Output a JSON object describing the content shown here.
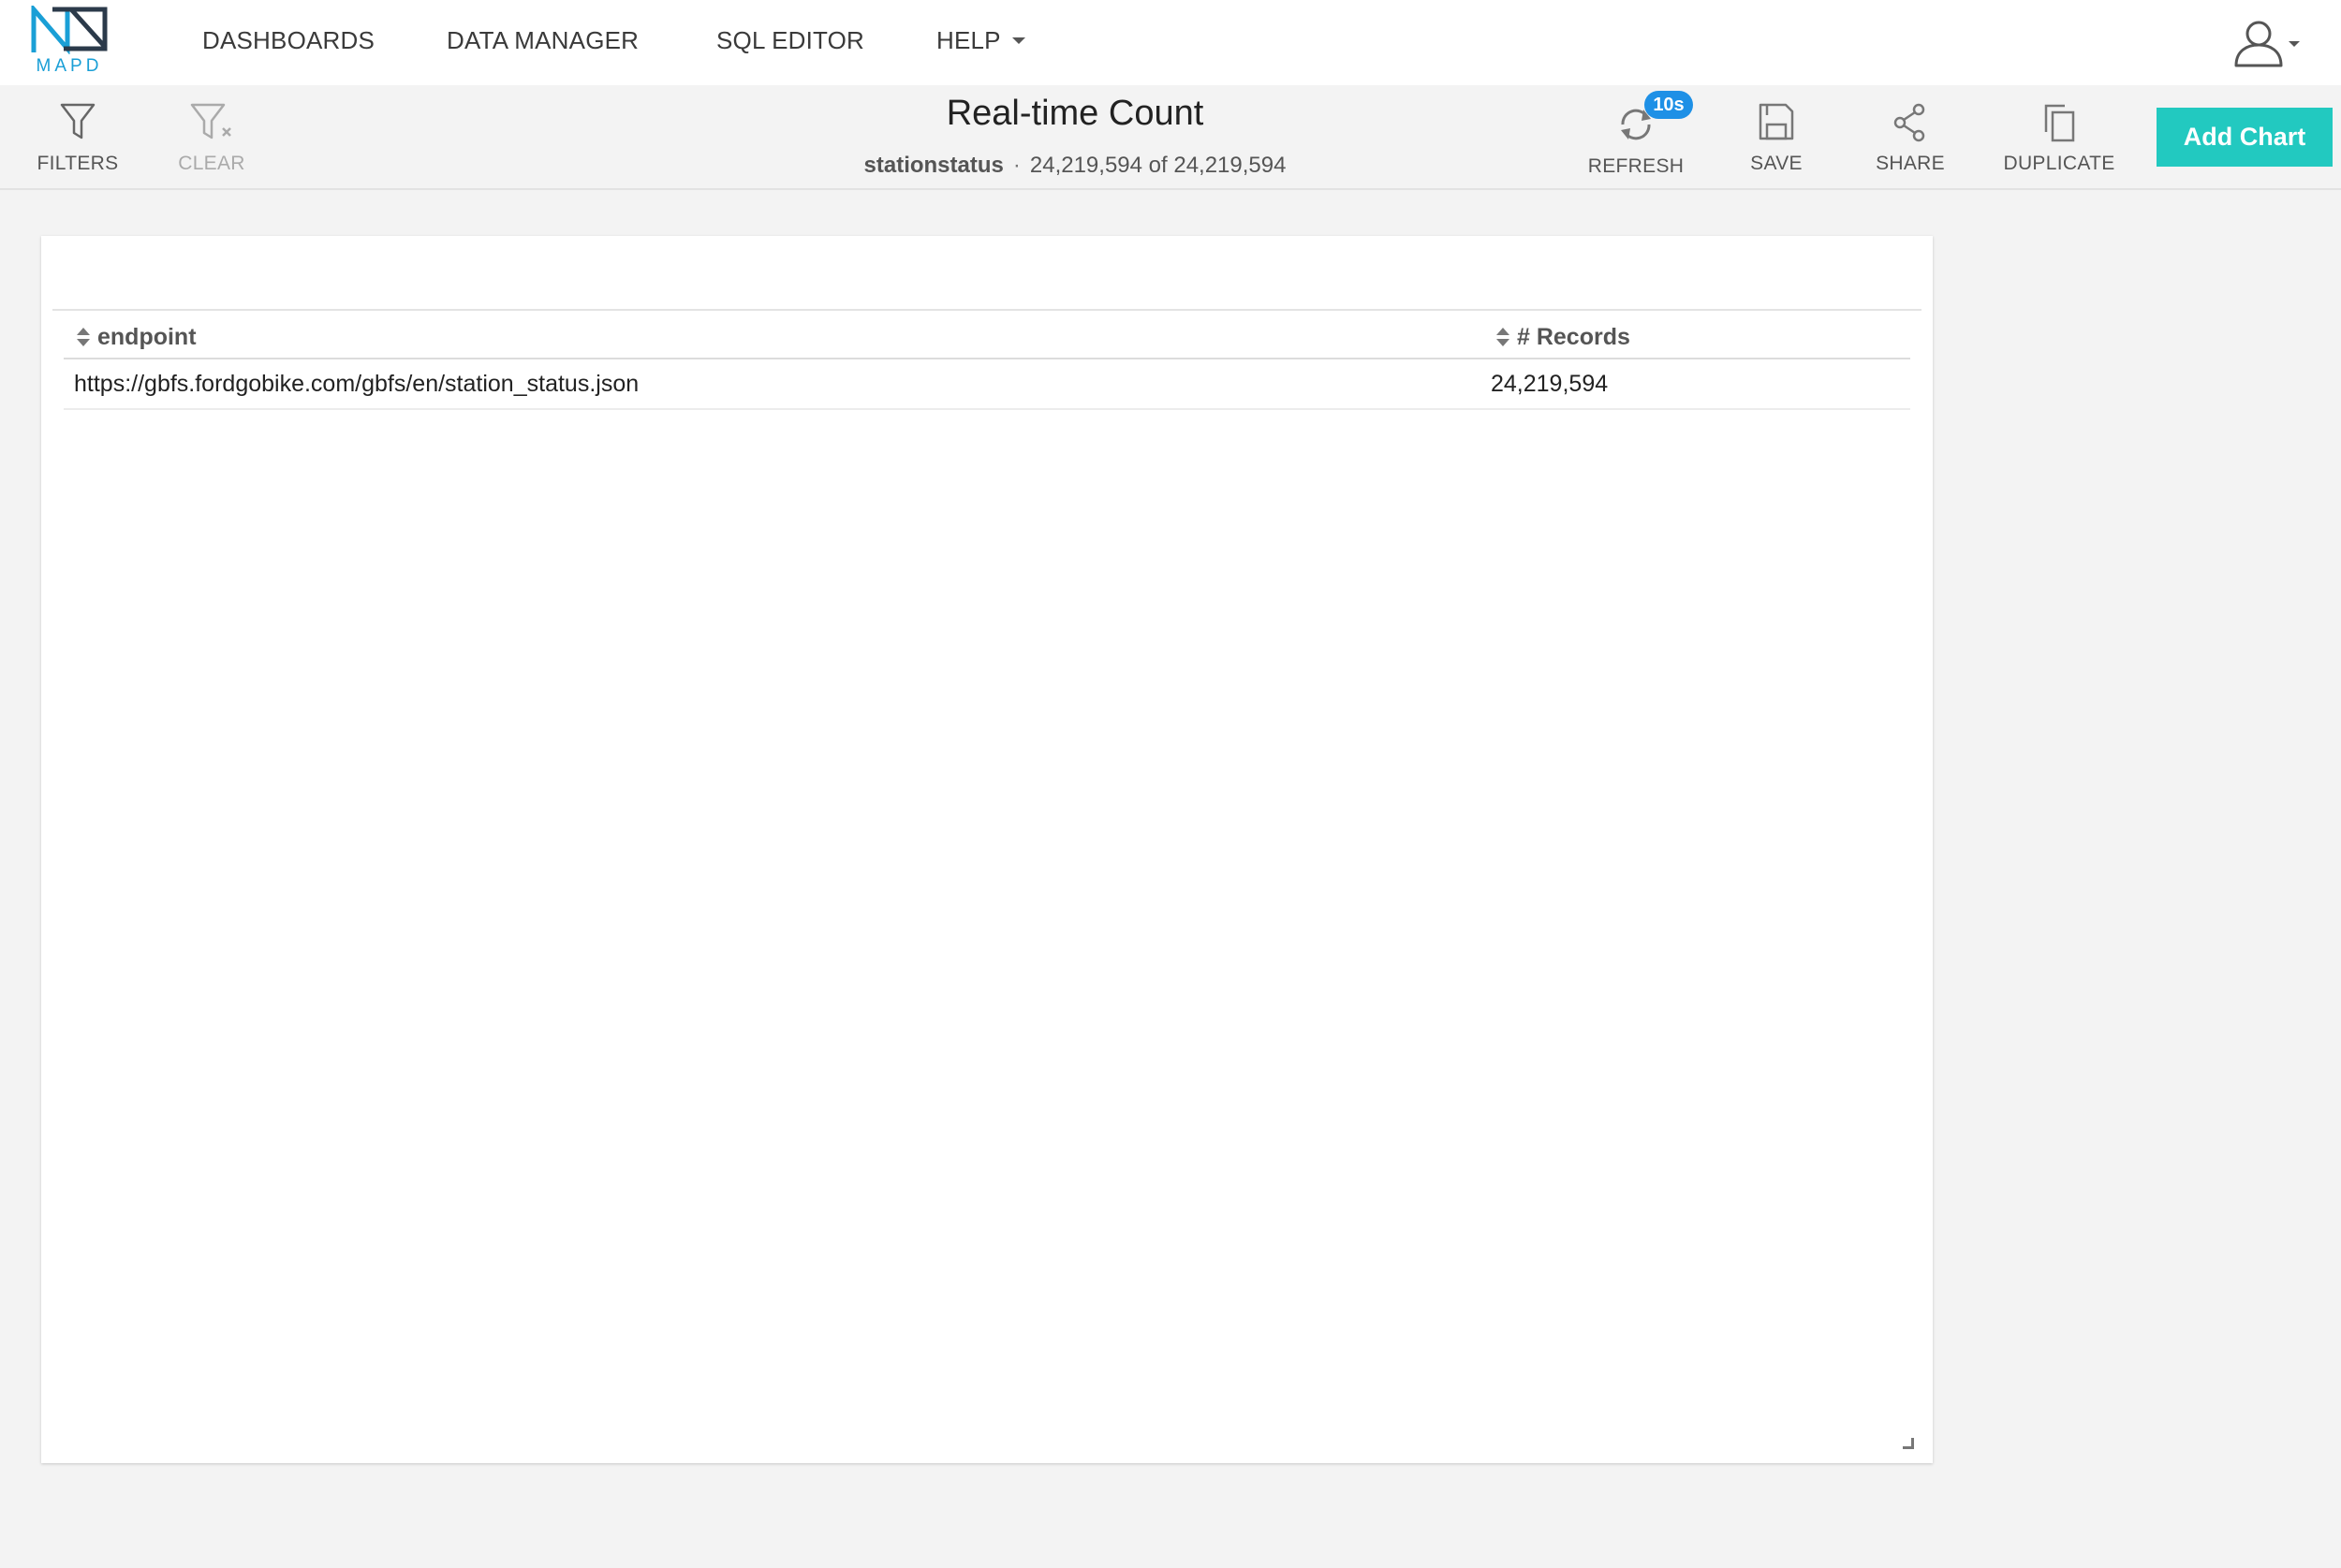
{
  "app": {
    "logo_text": "MAPD",
    "brand_color": "#1a9fd6"
  },
  "nav": {
    "items": [
      {
        "label": "DASHBOARDS"
      },
      {
        "label": "DATA MANAGER"
      },
      {
        "label": "SQL EDITOR"
      },
      {
        "label": "HELP"
      }
    ],
    "user_icon": "user-icon"
  },
  "toolbar": {
    "filters_label": "FILTERS",
    "clear_label": "CLEAR",
    "refresh_label": "REFRESH",
    "refresh_badge": "10s",
    "save_label": "SAVE",
    "share_label": "SHARE",
    "duplicate_label": "DUPLICATE",
    "add_chart_label": "Add Chart",
    "accent_color": "#22c9c0",
    "badge_color": "#1e90e6"
  },
  "dashboard": {
    "title": "Real-time Count",
    "source": "stationstatus",
    "separator": "·",
    "count_text": "24,219,594 of 24,219,594"
  },
  "table": {
    "columns": [
      "endpoint",
      "# Records"
    ],
    "rows": [
      [
        "https://gbfs.fordgobike.com/gbfs/en/station_status.json",
        "24,219,594"
      ]
    ]
  }
}
